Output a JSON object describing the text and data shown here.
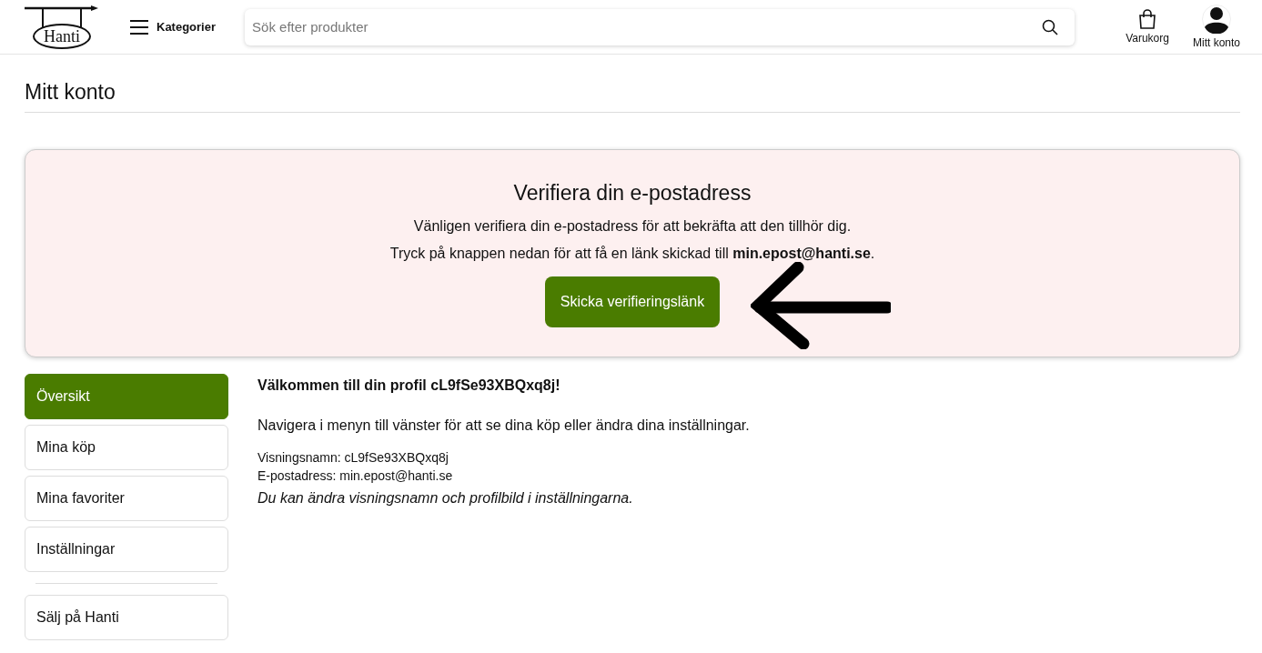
{
  "header": {
    "logo": "Hanti",
    "categories": "Kategorier",
    "search": {
      "placeholder": "Sök efter produkter"
    },
    "cart": "Varukorg",
    "account": "Mitt konto"
  },
  "page_title": "Mitt konto",
  "verify_banner": {
    "title": "Verifiera din e-postadress",
    "line_1": "Vänligen verifiera din e-postadress för att bekräfta att den tillhör dig.",
    "line_2": "Tryck på knappen nedan för att få en länk skickad till **min.epost@hanti.se**.",
    "button": "Skicka verifieringslänk"
  },
  "sidebar": {
    "items": [
      {
        "label": "Översikt",
        "selected": true
      },
      {
        "label": "Mina köp",
        "selected": false
      },
      {
        "label": "Mina favoriter",
        "selected": false
      },
      {
        "label": "Inställningar",
        "selected": false
      }
    ],
    "extra_items": [
      {
        "label": "Sälj på Hanti",
        "selected": false
      }
    ]
  },
  "profile": {
    "welcome": "Välkommen till din profil cL9fSe93XBQxq8j!",
    "intro": "Navigera i menyn till vänster för att se dina köp eller ändra dina inställningar.",
    "display_name": "Visningsnamn: cL9fSe93XBQxq8j",
    "email": "E-postadress: min.epost@hanti.se",
    "note": "Du kan ändra visningsnamn och profilbild i inställningarna."
  }
}
